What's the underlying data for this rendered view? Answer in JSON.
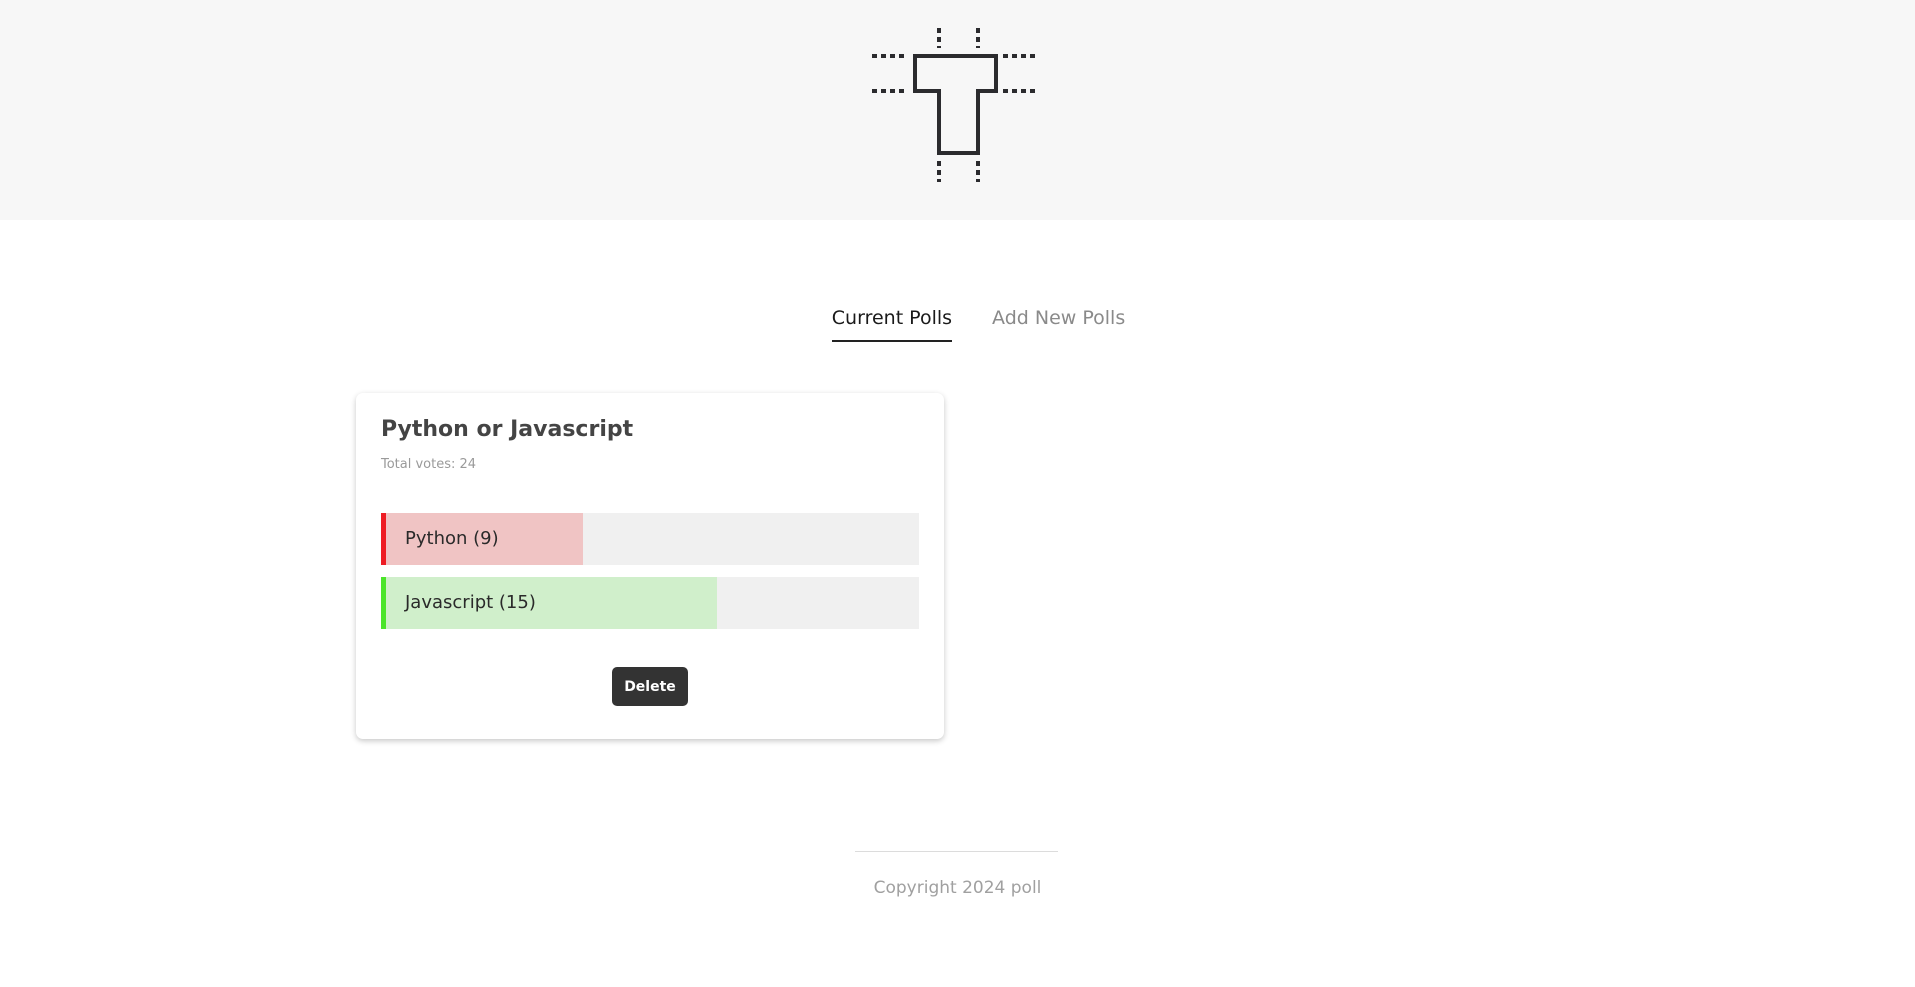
{
  "header": {
    "logo_icon": "t-frame-logo-icon",
    "background_color": "#f7f7f7"
  },
  "tabs": [
    {
      "label": "Current Polls",
      "active": true
    },
    {
      "label": "Add New Polls",
      "active": false
    }
  ],
  "poll": {
    "title": "Python or Javascript",
    "total_votes_text": "Total votes: 24",
    "total_votes": 24,
    "options": [
      {
        "label": "Python (9)",
        "votes": 9,
        "accent_color": "#ee1c24",
        "fill_color": "#f0c4c4"
      },
      {
        "label": "Javascript (15)",
        "votes": 15,
        "accent_color": "#4be52a",
        "fill_color": "#d0efcb"
      }
    ],
    "delete_label": "Delete"
  },
  "footer": {
    "copyright": "Copyright 2024 poll"
  }
}
